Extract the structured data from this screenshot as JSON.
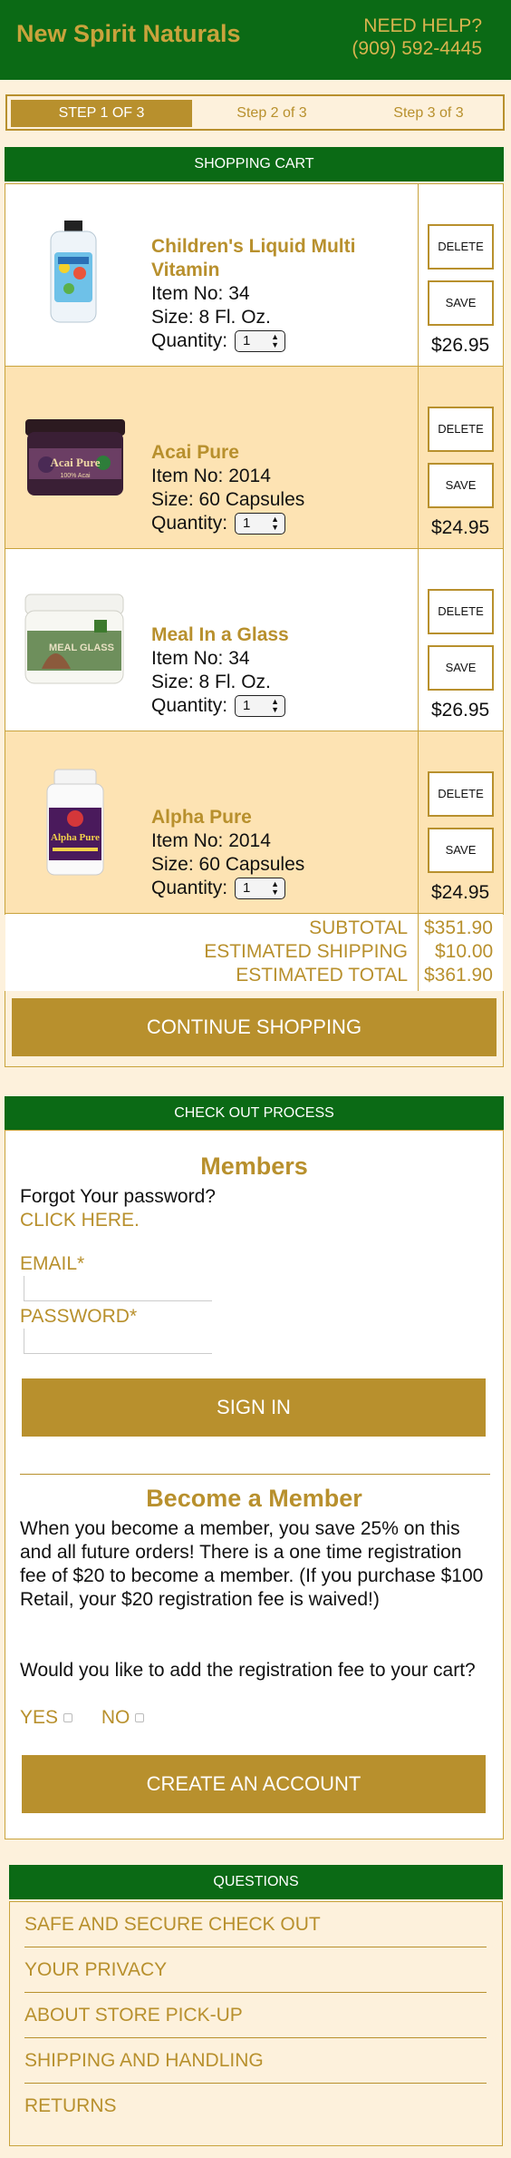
{
  "header": {
    "brand": "New Spirit Naturals",
    "help_label": "NEED HELP?",
    "help_phone": "(909) 592-4445"
  },
  "steps": [
    "STEP 1 OF 3",
    "Step 2 of 3",
    "Step 3 of 3"
  ],
  "cart": {
    "title": "SHOPPING CART",
    "items": [
      {
        "name_line1": "Children's Liquid Multi",
        "name_line2": "Vitamin",
        "item_no": "Item No: 34",
        "size": "Size: 8 Fl. Oz.",
        "qty_label": "Quantity:",
        "qty": "1",
        "price": "$26.95",
        "delete": "DELETE",
        "save": "SAVE"
      },
      {
        "name_line1": "Acai Pure",
        "name_line2": "",
        "item_no": "Item No: 2014",
        "size": "Size: 60 Capsules",
        "qty_label": "Quantity:",
        "qty": "1",
        "price": "$24.95",
        "delete": "DELETE",
        "save": "SAVE",
        "image_text": "Acai Pure",
        "image_subtext": "100% Acai"
      },
      {
        "name_line1": "Meal In a Glass",
        "name_line2": "",
        "item_no": "Item No: 34",
        "size": "Size: 8 Fl. Oz.",
        "qty_label": "Quantity:",
        "qty": "1",
        "price": "$26.95",
        "delete": "DELETE",
        "save": "SAVE",
        "image_text": "MEAL GLASS"
      },
      {
        "name_line1": "Alpha Pure",
        "name_line2": "",
        "item_no": "Item No: 2014",
        "size": "Size: 60 Capsules",
        "qty_label": "Quantity:",
        "qty": "1",
        "price": "$24.95",
        "delete": "DELETE",
        "save": "SAVE",
        "image_text": "Alpha Pure"
      }
    ],
    "subtotal_label": "SUBTOTAL",
    "subtotal": "$351.90",
    "shipping_label": "ESTIMATED SHIPPING",
    "shipping": "$10.00",
    "total_label": "ESTIMATED TOTAL",
    "total": "$361.90",
    "continue": "CONTINUE SHOPPING"
  },
  "checkout": {
    "title": "CHECK OUT PROCESS",
    "members_heading": "Members",
    "forgot": "Forgot Your password?",
    "click_here": "CLICK HERE.",
    "email_label": "EMAIL*",
    "password_label": "PASSWORD*",
    "sign_in": "SIGN IN",
    "become_heading": "Become a Member",
    "become_text": "When you become a member, you save 25% on this and all future orders! There is a one time registration fee of $20 to become a member. (If you purchase $100 Retail, your $20 registration fee is waived!)",
    "question": "Would you like to add the registration fee to your cart?",
    "yes": "YES",
    "no": "NO",
    "create": "CREATE AN ACCOUNT"
  },
  "questions": {
    "title": "QUESTIONS",
    "items": [
      "SAFE AND SECURE CHECK OUT",
      "YOUR PRIVACY",
      "ABOUT STORE PICK-UP",
      "SHIPPING AND HANDLING",
      "RETURNS"
    ]
  },
  "colors": {
    "green": "#0b6a15",
    "gold": "#b8902d",
    "cream": "#fdf1dc",
    "peach": "#fde3b3"
  }
}
